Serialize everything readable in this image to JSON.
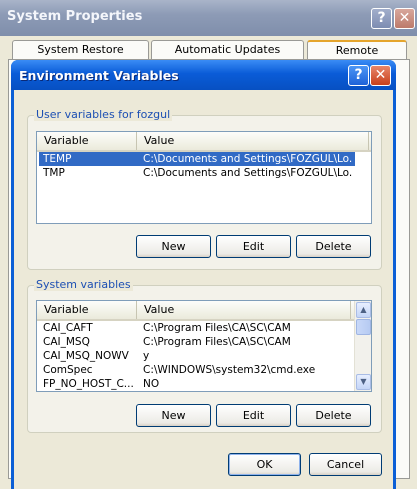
{
  "background_window": {
    "title": "System Properties",
    "help_glyph": "?",
    "close_glyph": "✕",
    "tabs": [
      "System Restore",
      "Automatic Updates",
      "Remote"
    ]
  },
  "dialog": {
    "title": "Environment Variables",
    "help_glyph": "?",
    "close_glyph": "✕",
    "user_group": {
      "legend": "User variables for fozgul",
      "columns": [
        "Variable",
        "Value"
      ],
      "rows": [
        {
          "variable": "TEMP",
          "value": "C:\\Documents and Settings\\FOZGUL\\Lo...",
          "selected": true
        },
        {
          "variable": "TMP",
          "value": "C:\\Documents and Settings\\FOZGUL\\Lo...",
          "selected": false
        }
      ],
      "buttons": {
        "new": "New",
        "edit": "Edit",
        "delete": "Delete"
      }
    },
    "system_group": {
      "legend": "System variables",
      "columns": [
        "Variable",
        "Value"
      ],
      "rows": [
        {
          "variable": "CAI_CAFT",
          "value": "C:\\Program Files\\CA\\SC\\CAM"
        },
        {
          "variable": "CAI_MSQ",
          "value": "C:\\Program Files\\CA\\SC\\CAM"
        },
        {
          "variable": "CAI_MSQ_NOWV",
          "value": "y"
        },
        {
          "variable": "ComSpec",
          "value": "C:\\WINDOWS\\system32\\cmd.exe"
        },
        {
          "variable": "FP_NO_HOST_C...",
          "value": "NO"
        }
      ],
      "buttons": {
        "new": "New",
        "edit": "Edit",
        "delete": "Delete"
      }
    },
    "footer": {
      "ok": "OK",
      "cancel": "Cancel"
    }
  },
  "colors": {
    "title_blue": "#0a5cd8",
    "selection": "#316ac5",
    "legend_text": "#1c4fb3",
    "dialog_face": "#ece9d8"
  },
  "icons": {
    "scroll_up": "▲",
    "scroll_down": "▼"
  }
}
